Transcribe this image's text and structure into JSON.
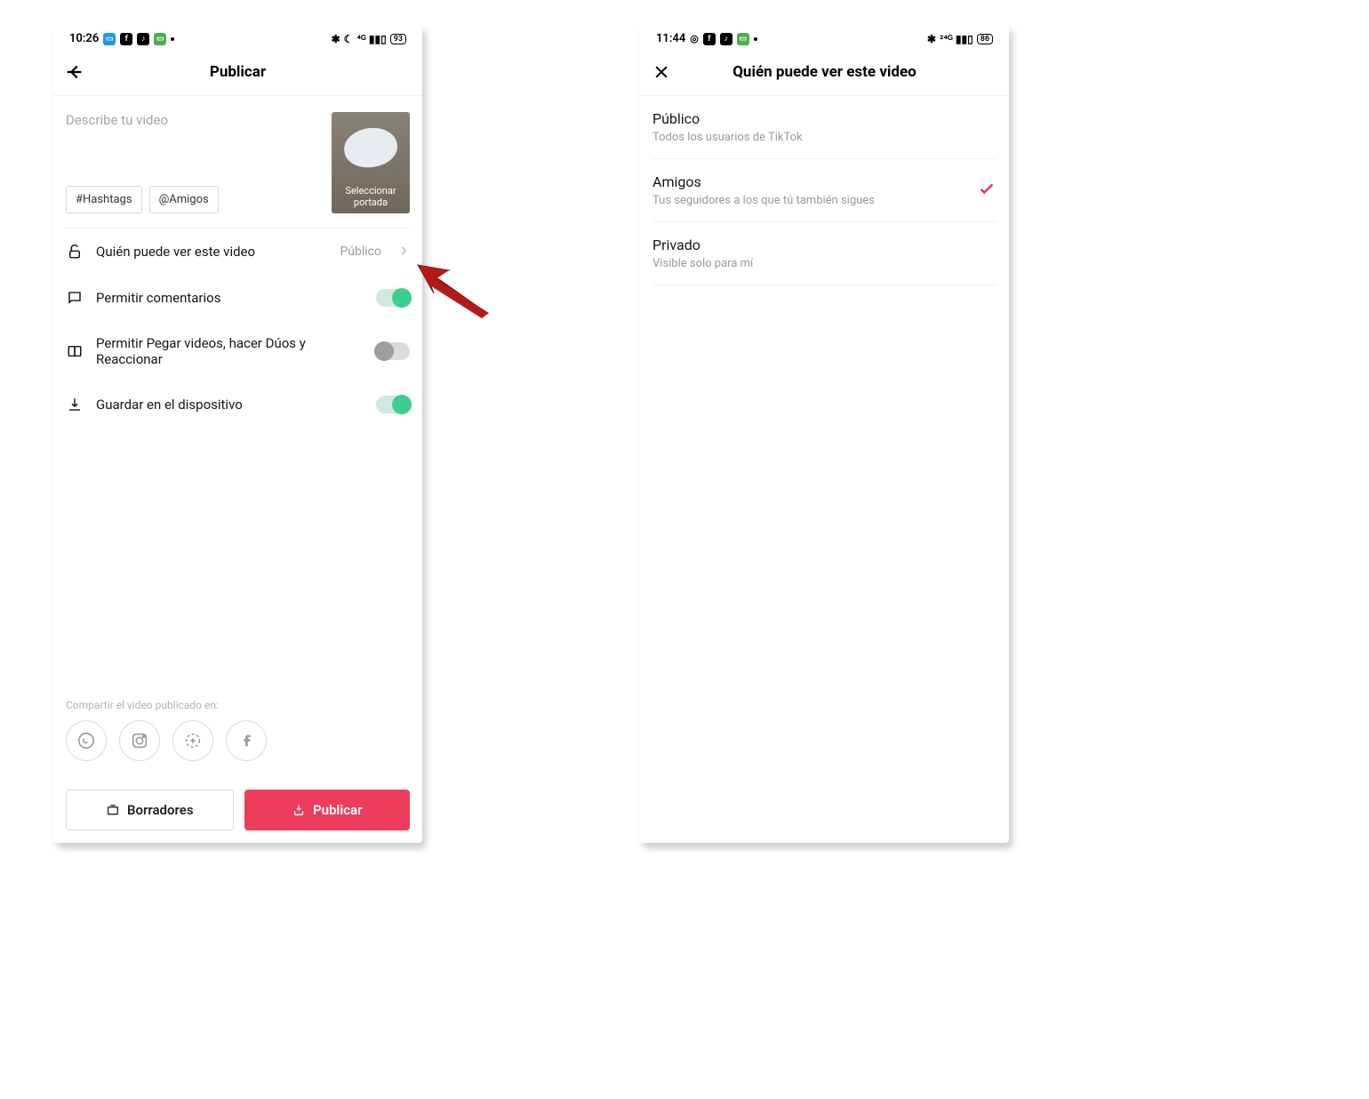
{
  "phone1": {
    "status": {
      "time": "10:26",
      "battery": "93"
    },
    "nav": {
      "title": "Publicar"
    },
    "compose": {
      "placeholder": "Describe tu video",
      "chip_hashtags": "#Hashtags",
      "chip_friends": "@Amigos",
      "thumb_caption": "Seleccionar portada"
    },
    "settings": {
      "visibility_label": "Quién puede ver este video",
      "visibility_value": "Público",
      "comments_label": "Permitir comentarios",
      "stitch_label": "Permitir Pegar videos, hacer Dúos y Reaccionar",
      "save_label": "Guardar en el dispositivo"
    },
    "share": {
      "label": "Compartir el video publicado en:"
    },
    "buttons": {
      "drafts": "Borradores",
      "publish": "Publicar"
    }
  },
  "phone2": {
    "status": {
      "time": "11:44",
      "battery": "86"
    },
    "nav": {
      "title": "Quién puede ver este video"
    },
    "options": [
      {
        "title": "Público",
        "sub": "Todos los usuarios de TikTok",
        "selected": false
      },
      {
        "title": "Amigos",
        "sub": "Tus seguidores a los que tú también sigues",
        "selected": true
      },
      {
        "title": "Privado",
        "sub": "Visible solo para mí",
        "selected": false
      }
    ]
  }
}
